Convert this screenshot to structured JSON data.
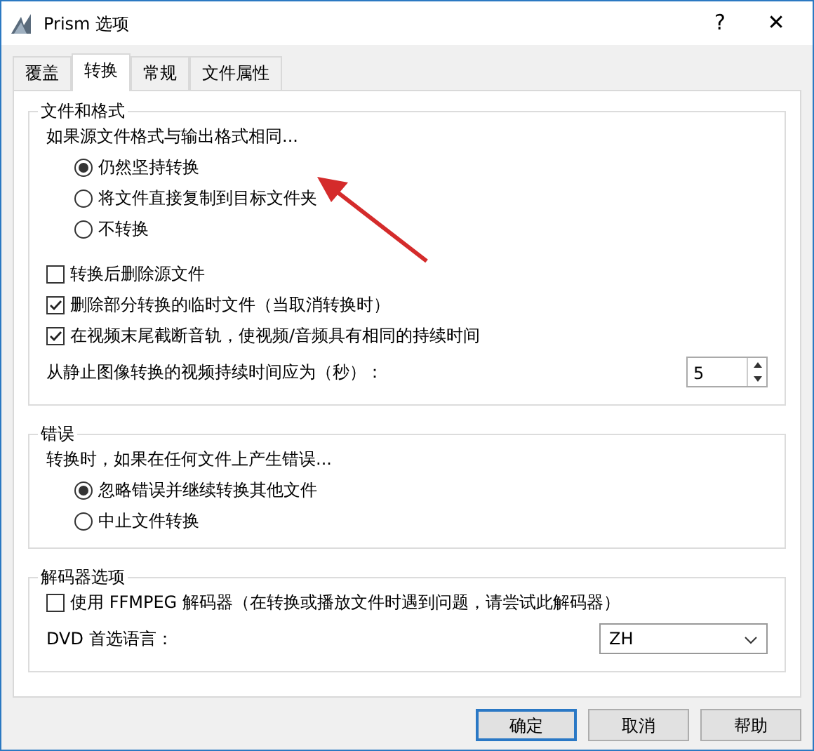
{
  "window": {
    "title": "Prism 选项",
    "help": "?",
    "close": "✕"
  },
  "tabs": [
    {
      "label": "覆盖",
      "selected": false
    },
    {
      "label": "转换",
      "selected": true
    },
    {
      "label": "常规",
      "selected": false
    },
    {
      "label": "文件属性",
      "selected": false
    }
  ],
  "groups": [
    {
      "title": "文件和格式",
      "items": [
        {
          "kind": "text",
          "text": "如果源文件格式与输出格式相同..."
        },
        {
          "kind": "radio",
          "label": "仍然坚持转换",
          "selected": true
        },
        {
          "kind": "radio",
          "label": "将文件直接复制到目标文件夹",
          "selected": false
        },
        {
          "kind": "radio",
          "label": "不转换",
          "selected": false
        },
        {
          "kind": "gap"
        },
        {
          "kind": "checkbox",
          "label": "转换后删除源文件",
          "checked": false
        },
        {
          "kind": "checkbox",
          "label": "删除部分转换的临时文件（当取消转换时）",
          "checked": true
        },
        {
          "kind": "checkbox",
          "label": "在视频末尾截断音轨，使视频/音频具有相同的持续时间",
          "checked": true
        },
        {
          "kind": "spin",
          "label": "从静止图像转换的视频持续时间应为（秒）：",
          "value": "5"
        }
      ]
    },
    {
      "title": "错误",
      "items": [
        {
          "kind": "text",
          "text": "转换时，如果在任何文件上产生错误..."
        },
        {
          "kind": "radio",
          "label": "忽略错误并继续转换其他文件",
          "selected": true
        },
        {
          "kind": "radio",
          "label": "中止文件转换",
          "selected": false
        }
      ]
    },
    {
      "title": "解码器选项",
      "items": [
        {
          "kind": "checkbox",
          "label": "使用 FFMPEG 解码器（在转换或播放文件时遇到问题，请尝试此解码器）",
          "checked": false
        },
        {
          "kind": "select",
          "label": "DVD 首选语言：",
          "value": "ZH"
        }
      ]
    }
  ],
  "buttons": [
    {
      "label": "确定",
      "default": true
    },
    {
      "label": "取消",
      "default": false
    },
    {
      "label": "帮助",
      "default": false
    }
  ]
}
